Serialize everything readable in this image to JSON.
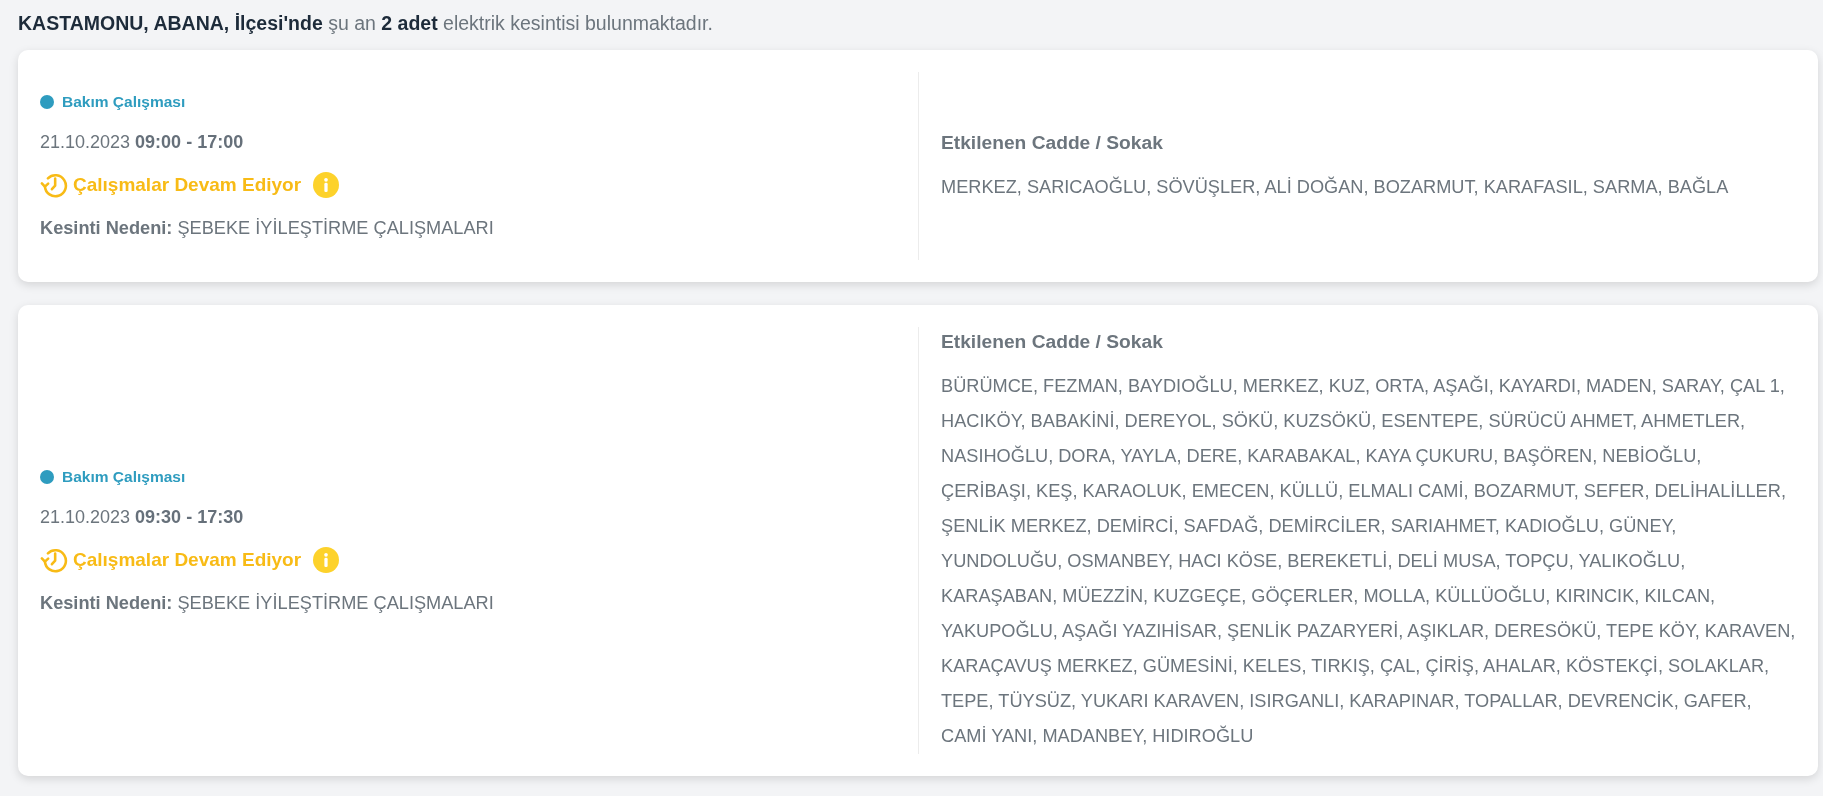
{
  "summary": "**KASTAMONU, ABANA, İlçesi'nde** şu an **2 adet** elektrik kesintisi bulunmaktadır.",
  "outages": [
    {
      "type": "Bakım Çalışması",
      "datetime": "21.10.2023 **09:00 - 17:00**",
      "status": "Çalışmalar Devam Ediyor",
      "reason": "**Kesinti Nedeni:** ŞEBEKE İYİLEŞTİRME ÇALIŞMALARI",
      "streets_title": "Etkilenen Cadde / Sokak",
      "streets": "MERKEZ, SARICAOĞLU, SÖVÜŞLER, ALİ DOĞAN, BOZARMUT, KARAFASIL, SARMA, BAĞLA"
    },
    {
      "type": "Bakım Çalışması",
      "datetime": "21.10.2023 **09:30 - 17:30**",
      "status": "Çalışmalar Devam Ediyor",
      "reason": "**Kesinti Nedeni:** ŞEBEKE İYİLEŞTİRME ÇALIŞMALARI",
      "streets_title": "Etkilenen Cadde / Sokak",
      "streets": "BÜRÜMCE, FEZMAN, BAYDIOĞLU, MERKEZ, KUZ, ORTA, AŞAĞI, KAYARDI, MADEN, SARAY, ÇAL 1, HACIKÖY, BABAKİNİ, DEREYOL, SÖKÜ, KUZSÖKÜ, ESENTEPE, SÜRÜCÜ AHMET, AHMETLER, NASIHOĞLU, DORA, YAYLA, DERE, KARABAKAL, KAYA ÇUKURU, BAŞÖREN, NEBİOĞLU, ÇERİBAŞI, KEŞ, KARAOLUK, EMECEN, KÜLLÜ, ELMALI CAMİ, BOZARMUT, SEFER, DELİHALİLLER, ŞENLİK MERKEZ, DEMİRCİ, SAFDAĞ, DEMİRCİLER, SARIAHMET, KADIOĞLU, GÜNEY, YUNDOLUĞU, OSMANBEY, HACI KÖSE, BEREKETLİ, DELİ MUSA, TOPÇU, YALIKOĞLU, KARAŞABAN, MÜEZZİN, KUZGEÇE, GÖÇERLER, MOLLA, KÜLLÜOĞLU, KIRINCIK, KILCAN, YAKUPOĞLU, AŞAĞI YAZIHİSAR, ŞENLİK PAZARYERİ, AŞIKLAR, DERESÖKÜ, TEPE KÖY, KARAVEN, KARAÇAVUŞ MERKEZ, GÜMESİNİ, KELES, TIRKIŞ, ÇAL, ÇİRİŞ, AHALAR, KÖSTEKÇİ, SOLAKLAR, TEPE, TÜYSÜZ, YUKARI KARAVEN, ISIRGANLI, KARAPINAR, TOPALLAR, DEVRENCİK, GAFER, CAMİ YANI, MADANBEY, HIDIROĞLU"
    }
  ]
}
